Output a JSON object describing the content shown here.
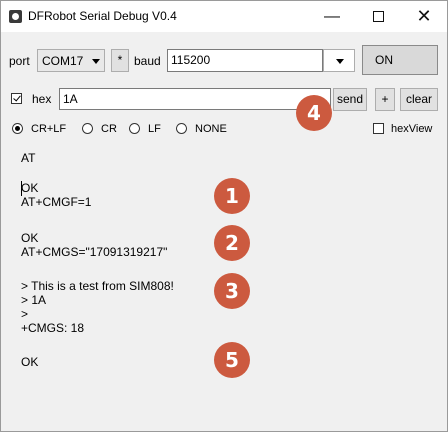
{
  "window": {
    "title": "DFRobot Serial Debug V0.4"
  },
  "toolbar": {
    "port_label": "port",
    "port_value": "COM17",
    "star_label": "*",
    "baud_label": "baud",
    "baud_value": "115200",
    "on_label": "ON"
  },
  "send_row": {
    "hex_label": "hex",
    "hex_checked": true,
    "input_value": "1A",
    "send_label": "send",
    "plus_label": "+",
    "clear_label": "clear"
  },
  "options_row": {
    "line_endings": [
      "CR+LF",
      "CR",
      "LF",
      "NONE"
    ],
    "selected": "CR+LF",
    "hexview_label": "hexView",
    "hexview_checked": false
  },
  "console_lines": [
    "AT",
    "",
    "OK",
    "AT+CMGF=1",
    "",
    "OK",
    "AT+CMGS=\"17091319217\"",
    "",
    "> This is a test from SIM808!",
    "> 1A",
    ">",
    "+CMGS: 18",
    "",
    "OK"
  ],
  "badges": [
    "1",
    "2",
    "3",
    "4",
    "5"
  ],
  "colors": {
    "badge": "#cc5a3f"
  }
}
